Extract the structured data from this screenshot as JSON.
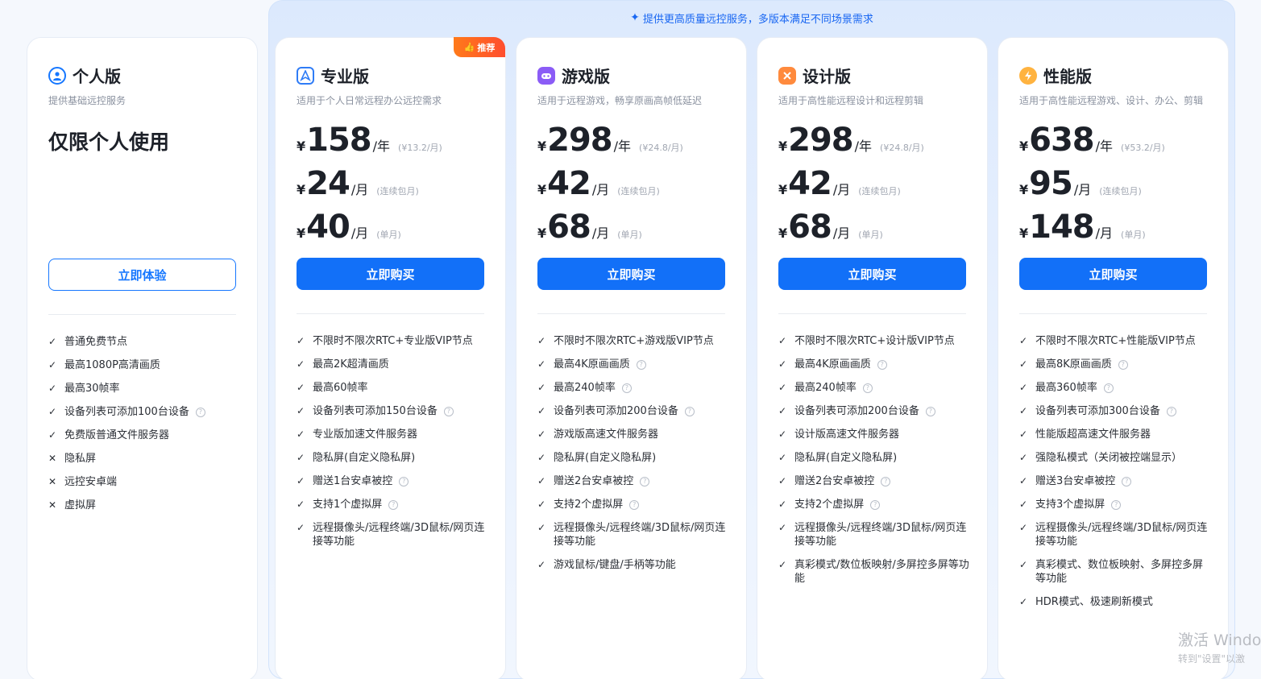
{
  "banner": {
    "icon": "sparkle-icon",
    "text": "提供更高质量远控服务，多版本满足不同场景需求"
  },
  "recommend_badge": {
    "icon": "thumbs-up-icon",
    "label": "推荐"
  },
  "plans": [
    {
      "id": "personal",
      "icon": "user-circle-icon",
      "title": "个人版",
      "subtitle": "提供基础远控服务",
      "slogan": "仅限个人使用",
      "button": "立即体验",
      "features": [
        {
          "mark": "check",
          "text": "普通免费节点"
        },
        {
          "mark": "check",
          "text": "最高1080P高清画质"
        },
        {
          "mark": "check",
          "text": "最高30帧率"
        },
        {
          "mark": "check",
          "text": "设备列表可添加100台设备",
          "help": true
        },
        {
          "mark": "check",
          "text": "免费版普通文件服务器"
        },
        {
          "mark": "cross",
          "text": "隐私屏"
        },
        {
          "mark": "cross",
          "text": "远控安卓端"
        },
        {
          "mark": "cross",
          "text": "虚拟屏"
        }
      ]
    },
    {
      "id": "pro",
      "icon": "pro-shield-icon",
      "title": "专业版",
      "subtitle": "适用于个人日常远程办公远控需求",
      "prices": [
        {
          "yen": "¥",
          "amount": "158",
          "unit": "/年",
          "note": "(¥13.2/月)"
        },
        {
          "yen": "¥",
          "amount": "24",
          "unit": "/月",
          "note": "(连续包月)"
        },
        {
          "yen": "¥",
          "amount": "40",
          "unit": "/月",
          "note": "(单月)"
        }
      ],
      "button": "立即购买",
      "features": [
        {
          "mark": "check",
          "text": "不限时不限次RTC+专业版VIP节点"
        },
        {
          "mark": "check",
          "text": "最高2K超清画质"
        },
        {
          "mark": "check",
          "text": "最高60帧率"
        },
        {
          "mark": "check",
          "text": "设备列表可添加150台设备",
          "help": true
        },
        {
          "mark": "check",
          "text": "专业版加速文件服务器"
        },
        {
          "mark": "check",
          "text": "隐私屏(自定义隐私屏)"
        },
        {
          "mark": "check",
          "text": "赠送1台安卓被控",
          "help": true
        },
        {
          "mark": "check",
          "text": "支持1个虚拟屏",
          "help": true
        },
        {
          "mark": "check",
          "text": "远程摄像头/远程终端/3D鼠标/网页连接等功能"
        }
      ]
    },
    {
      "id": "game",
      "icon": "gamepad-icon",
      "title": "游戏版",
      "subtitle": "适用于远程游戏，畅享原画高帧低延迟",
      "prices": [
        {
          "yen": "¥",
          "amount": "298",
          "unit": "/年",
          "note": "(¥24.8/月)"
        },
        {
          "yen": "¥",
          "amount": "42",
          "unit": "/月",
          "note": "(连续包月)"
        },
        {
          "yen": "¥",
          "amount": "68",
          "unit": "/月",
          "note": "(单月)"
        }
      ],
      "button": "立即购买",
      "features": [
        {
          "mark": "check",
          "text": "不限时不限次RTC+游戏版VIP节点"
        },
        {
          "mark": "check",
          "text": "最高4K原画画质",
          "help": true
        },
        {
          "mark": "check",
          "text": "最高240帧率",
          "help": true
        },
        {
          "mark": "check",
          "text": "设备列表可添加200台设备",
          "help": true
        },
        {
          "mark": "check",
          "text": "游戏版高速文件服务器"
        },
        {
          "mark": "check",
          "text": "隐私屏(自定义隐私屏)"
        },
        {
          "mark": "check",
          "text": "赠送2台安卓被控",
          "help": true
        },
        {
          "mark": "check",
          "text": "支持2个虚拟屏",
          "help": true
        },
        {
          "mark": "check",
          "text": "远程摄像头/远程终端/3D鼠标/网页连接等功能"
        },
        {
          "mark": "check",
          "text": "游戏鼠标/键盘/手柄等功能"
        }
      ]
    },
    {
      "id": "design",
      "icon": "design-palette-icon",
      "title": "设计版",
      "subtitle": "适用于高性能远程设计和远程剪辑",
      "prices": [
        {
          "yen": "¥",
          "amount": "298",
          "unit": "/年",
          "note": "(¥24.8/月)"
        },
        {
          "yen": "¥",
          "amount": "42",
          "unit": "/月",
          "note": "(连续包月)"
        },
        {
          "yen": "¥",
          "amount": "68",
          "unit": "/月",
          "note": "(单月)"
        }
      ],
      "button": "立即购买",
      "features": [
        {
          "mark": "check",
          "text": "不限时不限次RTC+设计版VIP节点"
        },
        {
          "mark": "check",
          "text": "最高4K原画画质",
          "help": true
        },
        {
          "mark": "check",
          "text": "最高240帧率",
          "help": true
        },
        {
          "mark": "check",
          "text": "设备列表可添加200台设备",
          "help": true
        },
        {
          "mark": "check",
          "text": "设计版高速文件服务器"
        },
        {
          "mark": "check",
          "text": "隐私屏(自定义隐私屏)"
        },
        {
          "mark": "check",
          "text": "赠送2台安卓被控",
          "help": true
        },
        {
          "mark": "check",
          "text": "支持2个虚拟屏",
          "help": true
        },
        {
          "mark": "check",
          "text": "远程摄像头/远程终端/3D鼠标/网页连接等功能"
        },
        {
          "mark": "check",
          "text": "真彩模式/数位板映射/多屏控多屏等功能"
        }
      ]
    },
    {
      "id": "performance",
      "icon": "lightning-icon",
      "title": "性能版",
      "subtitle": "适用于高性能远程游戏、设计、办公、剪辑",
      "prices": [
        {
          "yen": "¥",
          "amount": "638",
          "unit": "/年",
          "note": "(¥53.2/月)"
        },
        {
          "yen": "¥",
          "amount": "95",
          "unit": "/月",
          "note": "(连续包月)"
        },
        {
          "yen": "¥",
          "amount": "148",
          "unit": "/月",
          "note": "(单月)"
        }
      ],
      "button": "立即购买",
      "features": [
        {
          "mark": "check",
          "text": "不限时不限次RTC+性能版VIP节点"
        },
        {
          "mark": "check",
          "text": "最高8K原画画质",
          "help": true
        },
        {
          "mark": "check",
          "text": "最高360帧率",
          "help": true
        },
        {
          "mark": "check",
          "text": "设备列表可添加300台设备",
          "help": true
        },
        {
          "mark": "check",
          "text": "性能版超高速文件服务器"
        },
        {
          "mark": "check",
          "text": "强隐私模式（关闭被控端显示）"
        },
        {
          "mark": "check",
          "text": "赠送3台安卓被控",
          "help": true
        },
        {
          "mark": "check",
          "text": "支持3个虚拟屏",
          "help": true
        },
        {
          "mark": "check",
          "text": "远程摄像头/远程终端/3D鼠标/网页连接等功能"
        },
        {
          "mark": "check",
          "text": "真彩模式、数位板映射、多屏控多屏等功能"
        },
        {
          "mark": "check",
          "text": "HDR模式、极速刷新模式"
        }
      ]
    }
  ],
  "watermark": {
    "line1": "激活 Windo",
    "line2": "转到\"设置\"以激"
  },
  "colors": {
    "accent": "#1270f8",
    "badge": "#ff5a26",
    "text": "#1d2129",
    "muted": "#8a919f"
  }
}
